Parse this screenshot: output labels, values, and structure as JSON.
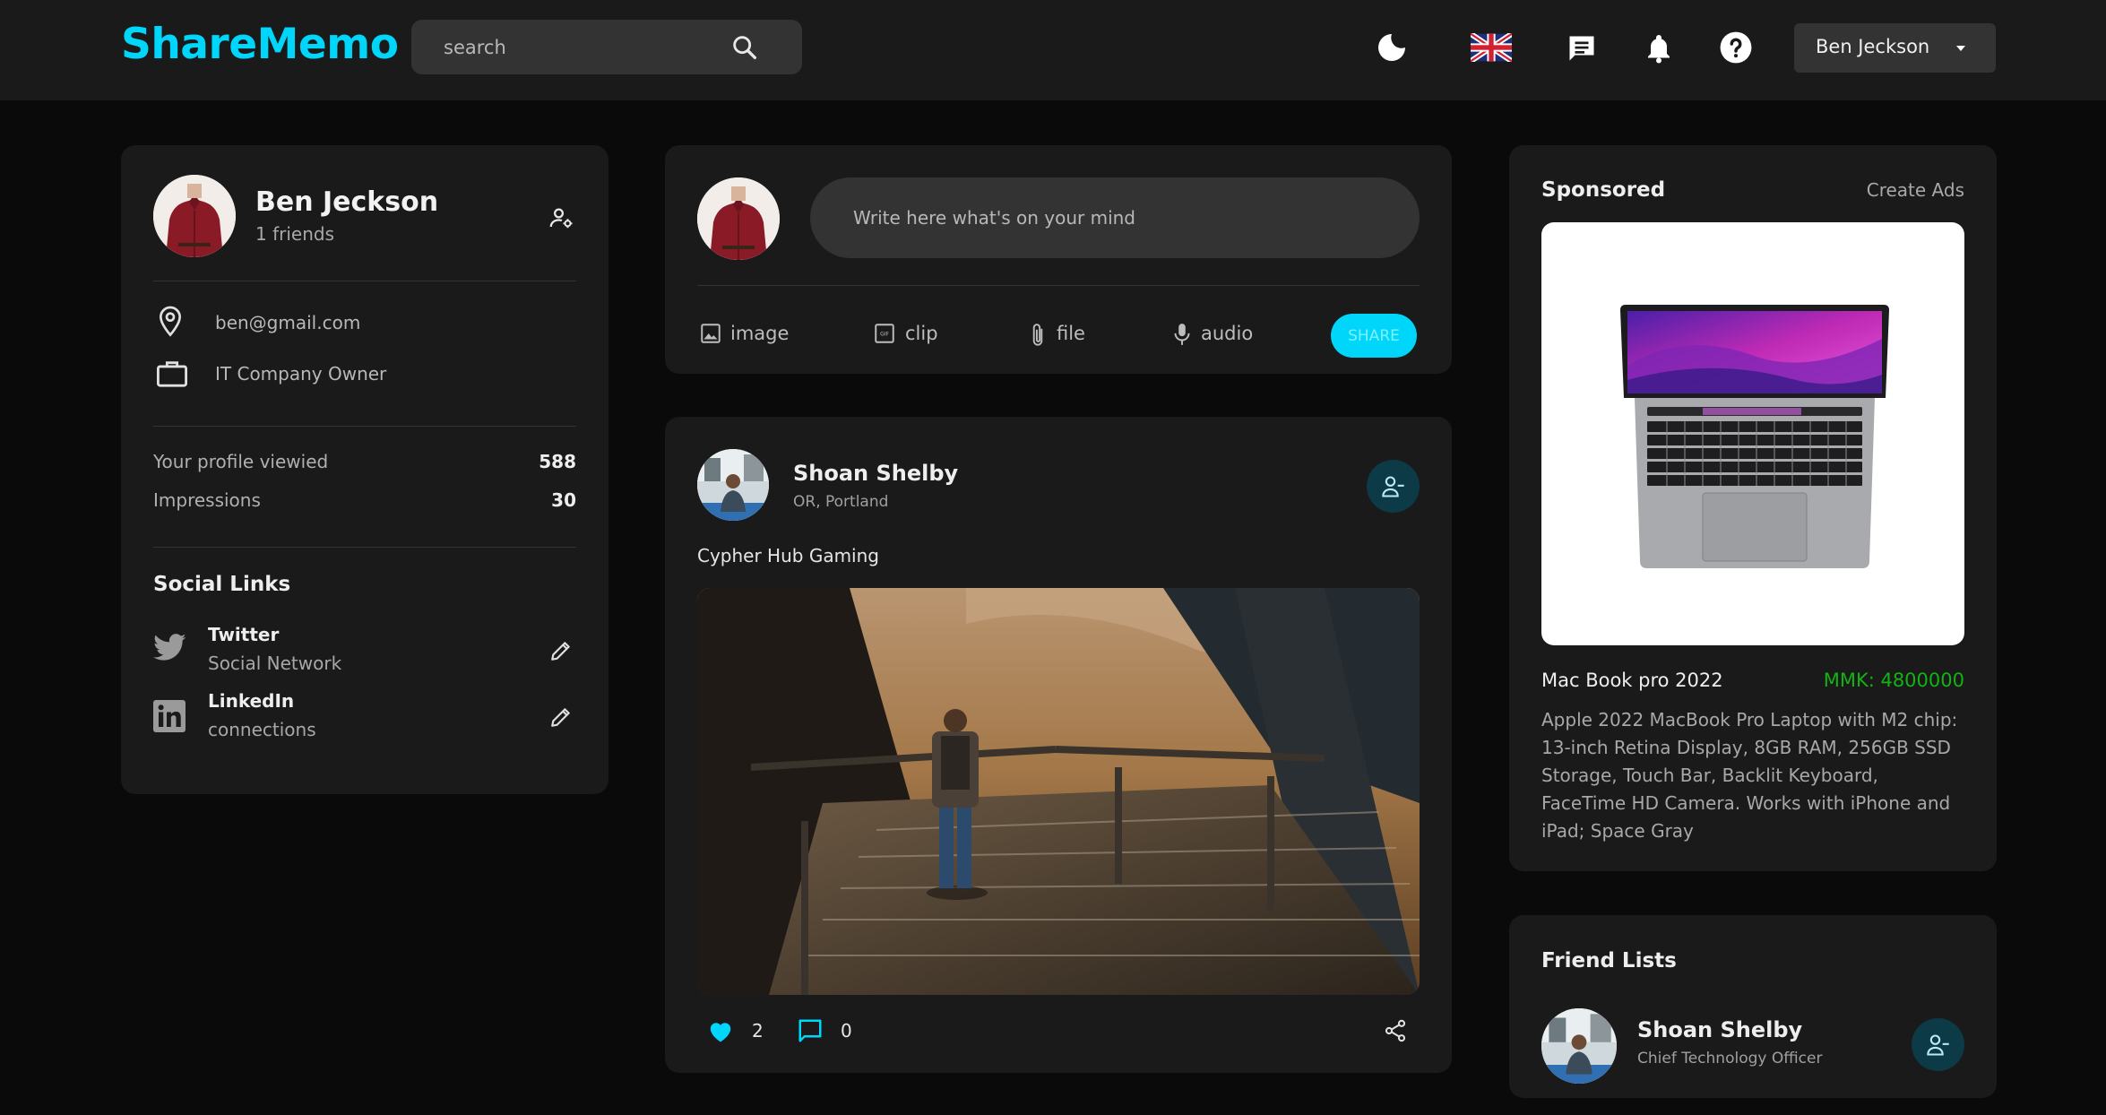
{
  "header": {
    "logo": "ShareMemo",
    "search_placeholder": "search",
    "icons": [
      "moon-icon",
      "uk-flag-icon",
      "message-icon",
      "bell-icon",
      "help-icon"
    ],
    "user_select": {
      "selected": "Ben Jeckson"
    }
  },
  "profile": {
    "name": "Ben Jeckson",
    "friends": "1 friends",
    "email": "ben@gmail.com",
    "occupation": "IT Company Owner",
    "stats": [
      {
        "label": "Your profile viewied",
        "value": "588"
      },
      {
        "label": "Impressions",
        "value": "30"
      }
    ],
    "social_title": "Social Links",
    "social_links": [
      {
        "name": "Twitter",
        "sub": "Social Network",
        "icon": "twitter-icon"
      },
      {
        "name": "LinkedIn",
        "sub": "connections",
        "icon": "linkedin-icon"
      }
    ]
  },
  "composer": {
    "placeholder": "Write here what's on your mind",
    "actions": [
      {
        "label": "image",
        "icon": "image-icon"
      },
      {
        "label": "clip",
        "icon": "gif-icon"
      },
      {
        "label": "file",
        "icon": "paperclip-icon"
      },
      {
        "label": "audio",
        "icon": "microphone-icon"
      }
    ],
    "share_label": "SHARE"
  },
  "post": {
    "author": "Shoan Shelby",
    "location": "OR, Portland",
    "text": "Cypher Hub Gaming",
    "likes": "2",
    "comments": "0"
  },
  "sponsored": {
    "title": "Sponsored",
    "create_link": "Create Ads",
    "product_name": "Mac Book pro 2022",
    "price": "MMK: 4800000",
    "description": "Apple 2022 MacBook Pro Laptop with M2 chip: 13-inch Retina Display, 8GB RAM, 256GB SSD Storage, Touch Bar, Backlit Keyboard, FaceTime HD Camera. Works with iPhone and iPad; Space Gray"
  },
  "friends": {
    "title": "Friend Lists",
    "items": [
      {
        "name": "Shoan Shelby",
        "role": "Chief Technology Officer"
      }
    ]
  },
  "colors": {
    "accent": "#00d5fa",
    "background": "#0a0a0a",
    "card": "#1a1a1a",
    "input": "#333333",
    "price": "#12b312",
    "icon_button_bg": "#0d3a47"
  }
}
